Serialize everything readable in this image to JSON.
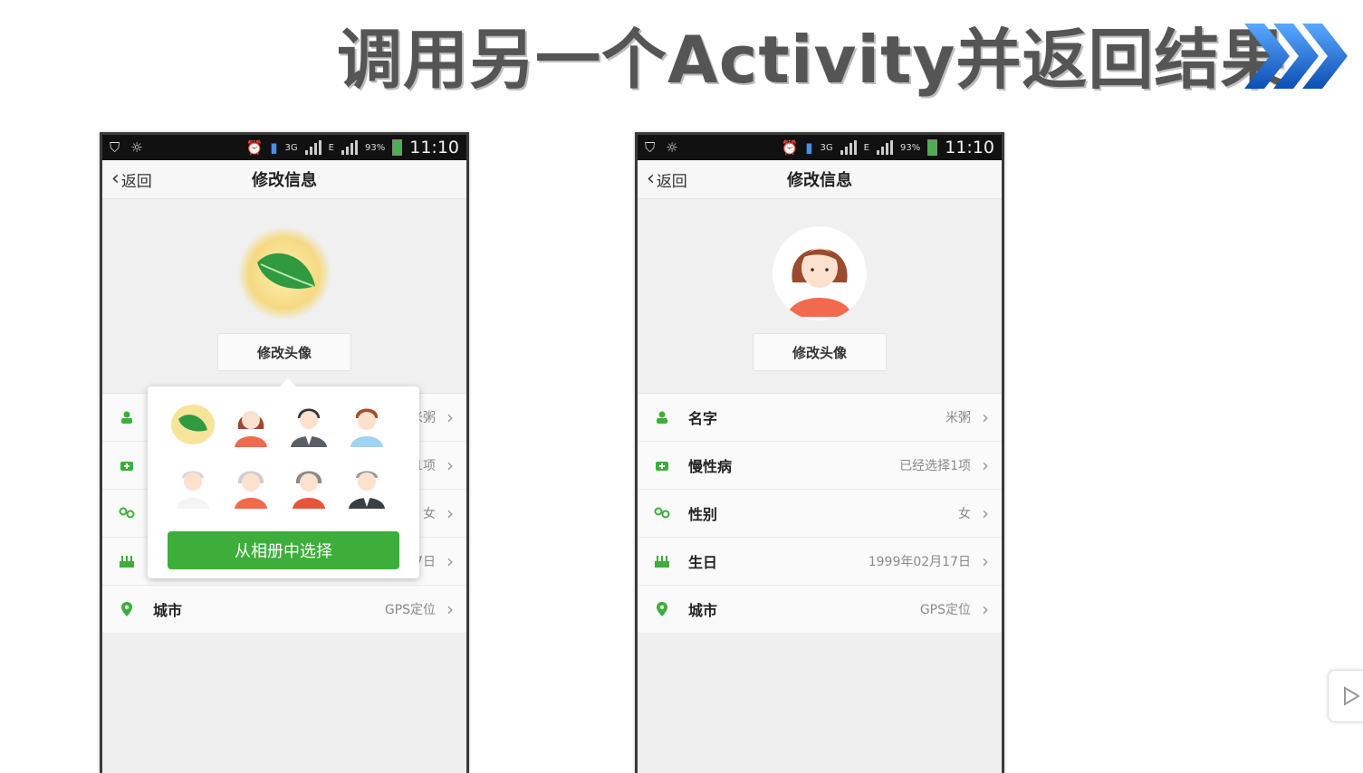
{
  "slide": {
    "title": "调用另一个Activity并返回结果"
  },
  "status_bar": {
    "net_3g": "3G",
    "net_e": "E",
    "battery": "93%",
    "time": "11:10"
  },
  "left_phone": {
    "back_label": "返回",
    "title": "修改信息",
    "edit_avatar": "修改头像",
    "rows": [
      {
        "label": "",
        "value": "米粥",
        "icon": "person-icon"
      },
      {
        "label": "",
        "value": "已经选择1项",
        "icon": "medkit-icon"
      },
      {
        "label": "",
        "value": "女",
        "icon": "gender-icon"
      },
      {
        "label": "",
        "value": "1999年02月17日",
        "icon": "cake-icon"
      },
      {
        "label": "城市",
        "value": "GPS定位",
        "icon": "location-pin-icon"
      }
    ],
    "popup": {
      "album_button": "从相册中选择",
      "avatars": [
        "leaf-avatar",
        "girl-avatar",
        "man-suit-avatar",
        "boy-avatar",
        "grandpa-avatar",
        "grandma-avatar",
        "woman-avatar",
        "old-man-suit-avatar"
      ]
    }
  },
  "right_phone": {
    "back_label": "返回",
    "title": "修改信息",
    "edit_avatar": "修改头像",
    "rows": [
      {
        "label": "名字",
        "value": "米粥",
        "icon": "person-icon"
      },
      {
        "label": "慢性病",
        "value": "已经选择1项",
        "icon": "medkit-icon"
      },
      {
        "label": "性别",
        "value": "女",
        "icon": "gender-icon"
      },
      {
        "label": "生日",
        "value": "1999年02月17日",
        "icon": "cake-icon"
      },
      {
        "label": "城市",
        "value": "GPS定位",
        "icon": "location-pin-icon"
      }
    ]
  },
  "colors": {
    "accent_green": "#3dae3a",
    "title_gray": "#555555",
    "chevron_blue": "#1e6fd0"
  }
}
